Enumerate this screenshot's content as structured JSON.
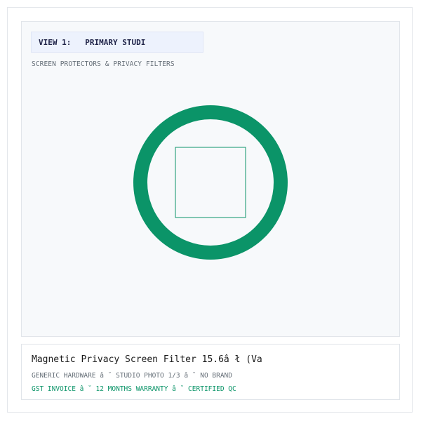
{
  "gallery": {
    "view_label": "VIEW 1:   PRIMARY STUDI",
    "category": "SCREEN PROTECTORS & PRIVACY FILTERS",
    "image": {
      "ring_color": "#0b9468",
      "square_color": "#0b9468",
      "panel_background": "#f7f9fb"
    }
  },
  "product": {
    "title": "Magnetic Privacy Screen Filter 15.6â ł (Va",
    "meta": "GENERIC HARDWARE â ˘ STUDIO PHOTO 1/3 â ˘ NO BRAND",
    "trust": "GST INVOICE â ˘ 12 MONTHS WARRANTY â ˘ CERTIFIED QC"
  }
}
